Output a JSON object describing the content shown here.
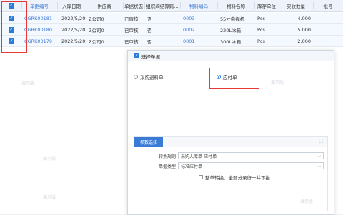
{
  "grid": {
    "columns": [
      "单据编号",
      "入库日期",
      "供应商",
      "单据状态",
      "组织间结算跨…",
      "物料编码",
      "物料名称",
      "库存单位",
      "实收数量",
      "批号"
    ],
    "rows": [
      {
        "bill_no": "CGRK00181",
        "date": "2022/5/20",
        "supplier": "Z公司0",
        "status": "已审核",
        "settle": "否",
        "material_code": "0003",
        "material_name": "55寸电视机",
        "unit": "Pcs",
        "qty": "4.000",
        "lot": ""
      },
      {
        "bill_no": "CGRK00180",
        "date": "2022/5/20",
        "supplier": "Z公司0",
        "status": "已审核",
        "settle": "否",
        "material_code": "0002",
        "material_name": "220L冰箱",
        "unit": "Pcs",
        "qty": "5.000",
        "lot": ""
      },
      {
        "bill_no": "CGRK00179",
        "date": "2022/5/20",
        "supplier": "Z公司0",
        "status": "已审核",
        "settle": "否",
        "material_code": "0001",
        "material_name": "300L冰箱",
        "unit": "Pcs",
        "qty": "2.000",
        "lot": ""
      }
    ]
  },
  "dialog": {
    "title": "选择单据",
    "option1": "采购退料单",
    "option2": "应付单",
    "selected": "应付单",
    "tab": "参数选择",
    "rule_label": "转换规则",
    "rule_value": "采购入库单-应付单",
    "type_label": "单据类型",
    "type_value": "标准应付单",
    "merge_label": "整单转换：全部分录行一并下推"
  },
  "watermark": "演示版",
  "colors": {
    "accent": "#2b7bdc",
    "highlight": "#e53935"
  }
}
